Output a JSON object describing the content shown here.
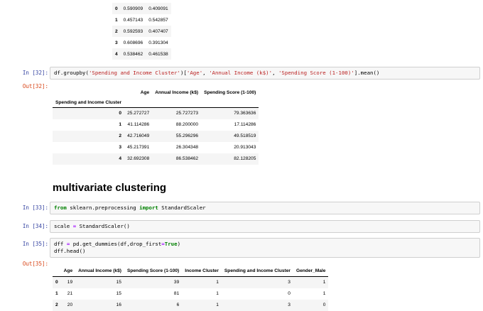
{
  "top_table": {
    "rows": [
      {
        "idx": "0",
        "a": "0.590909",
        "b": "0.409091"
      },
      {
        "idx": "1",
        "a": "0.457143",
        "b": "0.542857"
      },
      {
        "idx": "2",
        "a": "0.592593",
        "b": "0.407407"
      },
      {
        "idx": "3",
        "a": "0.608696",
        "b": "0.391304"
      },
      {
        "idx": "4",
        "a": "0.538462",
        "b": "0.461538"
      }
    ]
  },
  "cell32": {
    "in_prompt": "In [32]:",
    "out_prompt": "Out[32]:",
    "code": {
      "p1": "df.groupby(",
      "s1": "'Spending and Income Cluster'",
      "p2": ")[",
      "s2": "'Age'",
      "p3": ", ",
      "s3": "'Annual Income (k$)'",
      "p4": ", ",
      "s4": "'Spending Score (1-100)'",
      "p5": "].mean()"
    },
    "table": {
      "columns": [
        "Age",
        "Annual Income (k$)",
        "Spending Score (1-100)"
      ],
      "index_name": "Spending and Income Cluster",
      "rows": [
        {
          "idx": "0",
          "c": [
            "25.272727",
            "25.727273",
            "79.363636"
          ]
        },
        {
          "idx": "1",
          "c": [
            "41.114286",
            "88.200000",
            "17.114286"
          ]
        },
        {
          "idx": "2",
          "c": [
            "42.716049",
            "55.296296",
            "49.518519"
          ]
        },
        {
          "idx": "3",
          "c": [
            "45.217391",
            "26.304348",
            "20.913043"
          ]
        },
        {
          "idx": "4",
          "c": [
            "32.692308",
            "86.538462",
            "82.128205"
          ]
        }
      ]
    }
  },
  "section_heading": "multivariate clustering",
  "cell33": {
    "in_prompt": "In [33]:",
    "kw1": "from",
    "mod": " sklearn.preprocessing ",
    "kw2": "import",
    "name": " StandardScaler"
  },
  "cell34": {
    "in_prompt": "In [34]:",
    "lhs": "scale ",
    "op": "=",
    "rhs": " StandardScaler()"
  },
  "cell35": {
    "in_prompt": "In [35]:",
    "out_prompt": "Out[35]:",
    "line1_a": "dff ",
    "line1_op": "=",
    "line1_b": " pd.get_dummies(df,drop_first",
    "line1_op2": "=",
    "line1_kw": "True",
    "line1_c": ")",
    "line2": "dff.head()",
    "table": {
      "columns": [
        "Age",
        "Annual Income (k$)",
        "Spending Score (1-100)",
        "Income Cluster",
        "Spending and Income Cluster",
        "Gender_Male"
      ],
      "rows": [
        {
          "idx": "0",
          "c": [
            "19",
            "15",
            "39",
            "1",
            "3",
            "1"
          ]
        },
        {
          "idx": "1",
          "c": [
            "21",
            "15",
            "81",
            "1",
            "0",
            "1"
          ]
        },
        {
          "idx": "2",
          "c": [
            "20",
            "16",
            "6",
            "1",
            "3",
            "0"
          ]
        }
      ]
    }
  }
}
